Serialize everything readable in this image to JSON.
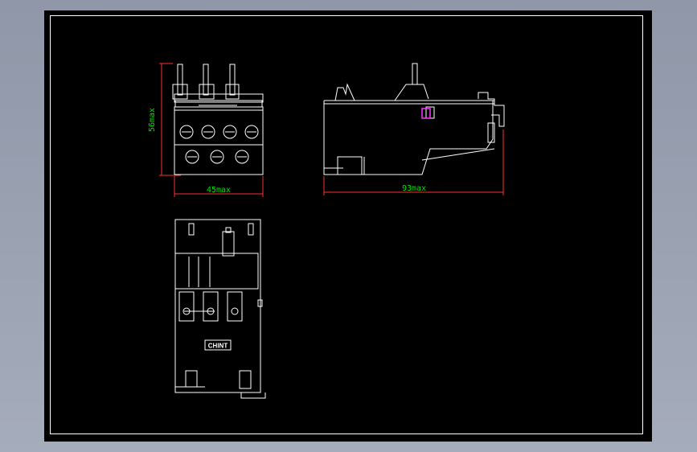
{
  "colors": {
    "background": "#000000",
    "lines": "#ffffff",
    "dimension_lines": "#ff3030",
    "dimension_text": "#00e000",
    "highlight": "#ff33ff"
  },
  "front_view": {
    "height_label": "56max",
    "width_label": "45max"
  },
  "side_view": {
    "length_label": "93max"
  },
  "bottom_view": {
    "brand_label": "CHINT"
  }
}
